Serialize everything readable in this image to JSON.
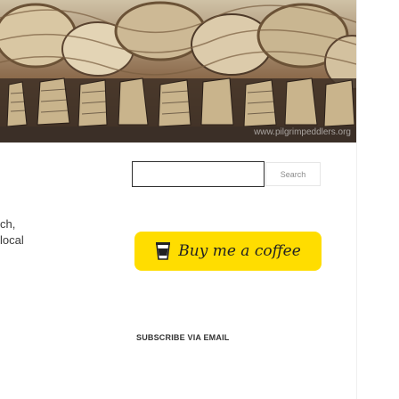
{
  "hero": {
    "watermark": "www.pilgrimpeddlers.org"
  },
  "search": {
    "placeholder": "",
    "value": "",
    "button_label": "Search"
  },
  "sidebar_fragments": {
    "line1": "ch,",
    "line2": "local"
  },
  "donate": {
    "label_plain": "Buy me a ",
    "label_accent": "coffee",
    "icon": "coffee-cup-icon",
    "color": "#ffdd00"
  },
  "subscribe": {
    "title": "SUBSCRIBE VIA EMAIL"
  }
}
